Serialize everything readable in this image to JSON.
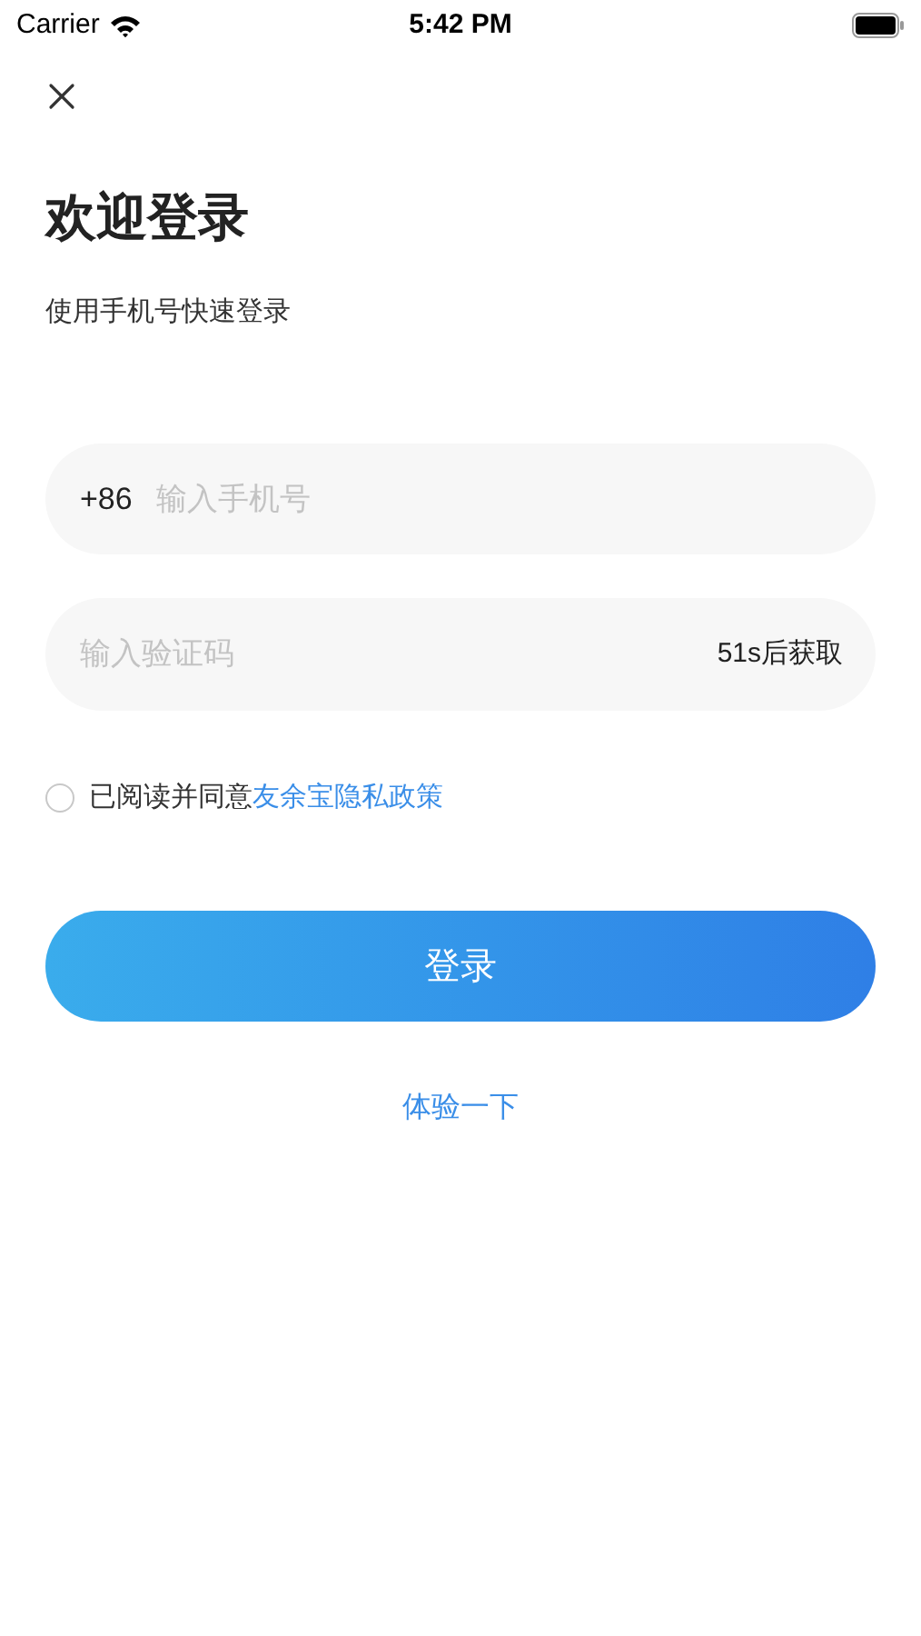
{
  "status_bar": {
    "carrier": "Carrier",
    "time": "5:42 PM"
  },
  "title": "欢迎登录",
  "subtitle": "使用手机号快速登录",
  "phone_field": {
    "prefix": "+86",
    "placeholder": "输入手机号"
  },
  "code_field": {
    "placeholder": "输入验证码",
    "countdown": "51s后获取"
  },
  "agreement": {
    "checked": false,
    "text": "已阅读并同意",
    "link": "友余宝隐私政策"
  },
  "login_button": "登录",
  "trial_link": "体验一下"
}
